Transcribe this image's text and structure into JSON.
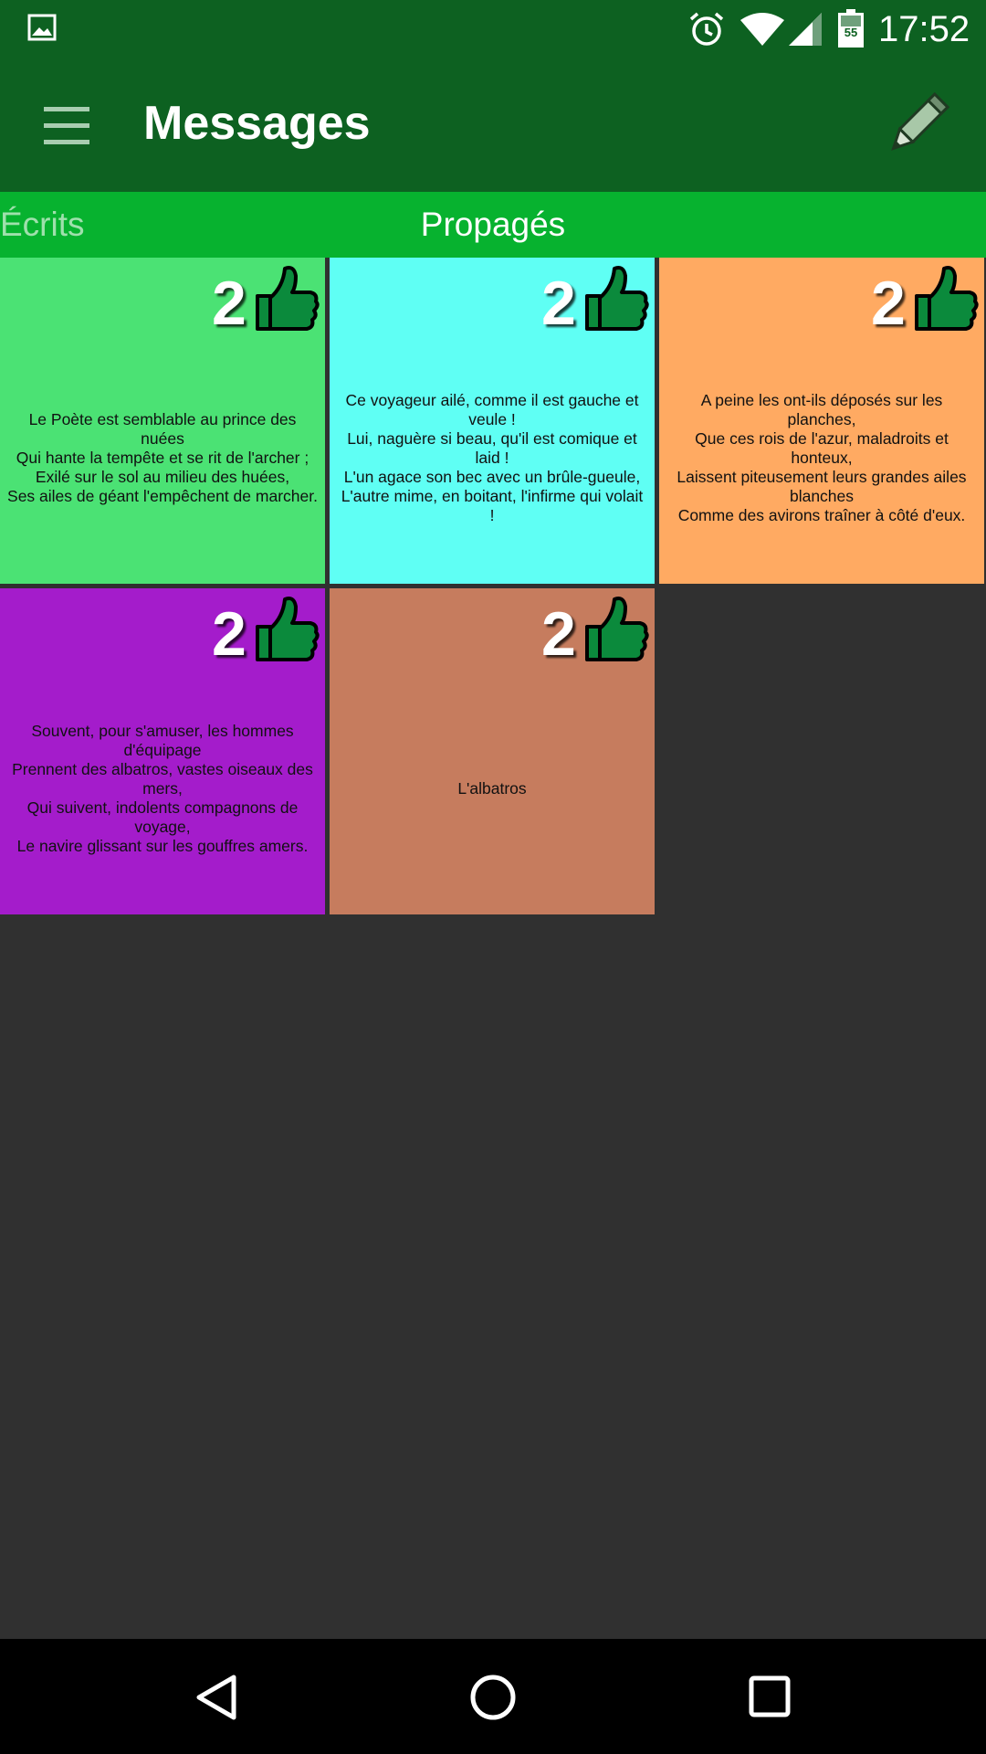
{
  "status_bar": {
    "time": "17:52",
    "battery_level": "55",
    "icons": [
      "image-icon",
      "alarm-icon",
      "wifi-icon",
      "signal-icon",
      "battery-icon"
    ]
  },
  "app_bar": {
    "title": "Messages",
    "menu_icon": "hamburger-menu-icon",
    "action_icon": "pencil-icon"
  },
  "tabs": [
    {
      "label": "Écrits",
      "selected": false
    },
    {
      "label": "Propagés",
      "selected": true
    }
  ],
  "cards": [
    {
      "count": "2",
      "color": "#4be274",
      "text": "Le Poète est semblable au prince des nuées\nQui hante la tempête et se rit de l'archer ;\nExilé sur le sol au milieu des huées,\nSes ailes de géant l'empêchent de marcher."
    },
    {
      "count": "2",
      "color": "#5ffff4",
      "text": "Ce voyageur ailé, comme il est gauche et veule !\nLui, naguère si beau, qu'il est comique et laid !\nL'un agace son bec avec un brûle-gueule,\nL'autre mime, en boitant, l'infirme qui volait !"
    },
    {
      "count": "2",
      "color": "#ffaa62",
      "text": "A peine les ont-ils déposés sur les planches,\nQue ces rois de l'azur, maladroits et honteux,\nLaissent piteusement leurs grandes ailes blanches\nComme des avirons traîner à côté d'eux."
    },
    {
      "count": "2",
      "color": "#a41ccb",
      "text": "Souvent, pour s'amuser, les hommes d'équipage\nPrennent des albatros, vastes oiseaux des mers,\nQui suivent, indolents compagnons de voyage,\nLe navire glissant sur les gouffres amers."
    },
    {
      "count": "2",
      "color": "#c67c5e",
      "text": "L'albatros"
    }
  ],
  "colors": {
    "primary_dark": "#0d6121",
    "tab_bar": "#07b22f",
    "background": "#303030",
    "thumb": "#0b8a3c"
  },
  "nav_bar": {
    "icons": [
      "back-icon",
      "home-icon",
      "recent-apps-icon"
    ]
  }
}
